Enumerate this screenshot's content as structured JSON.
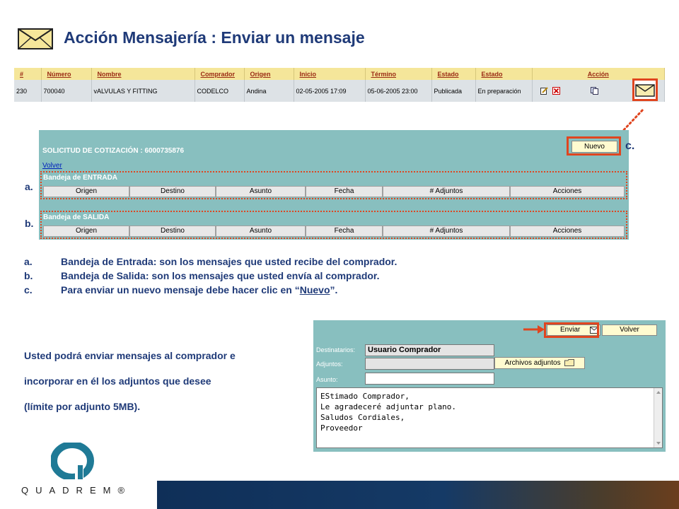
{
  "title": "Acción Mensajería : Enviar un mensaje",
  "colors": {
    "navy": "#1f3a78",
    "highlight": "#e0451f",
    "panel": "#88bfbf",
    "header_bg": "#f5e69a"
  },
  "order_table": {
    "headers": [
      "#",
      "Número",
      "Nombre",
      "Comprador",
      "Origen",
      "Inicio",
      "Término",
      "Estado",
      "Estado",
      "Acción"
    ],
    "row": [
      "230",
      "700040",
      "vALVULAS Y FITTING",
      "CODELCO",
      "Andina",
      "02-05-2005 17:09",
      "05-06-2005 23:00",
      "Publicada",
      "En preparación"
    ],
    "action_icons": [
      "edit-icon",
      "delete-icon",
      "copy-icon",
      "mail-icon"
    ]
  },
  "quote_panel": {
    "title": "SOLICITUD DE COTIZACIÓN : 6000735876",
    "volver_link": "Volver",
    "nuevo_button": "Nuevo",
    "inbox_title": "Bandeja de ENTRADA",
    "outbox_title": "Bandeja de SALIDA",
    "columns": [
      "Origen",
      "Destino",
      "Asunto",
      "Fecha",
      "# Adjuntos",
      "Acciones"
    ]
  },
  "labels": {
    "a": "a.",
    "b": "b.",
    "c": "c."
  },
  "bullets": [
    {
      "key": "a.",
      "text": "Bandeja de Entrada: son los mensajes que usted recibe del comprador."
    },
    {
      "key": "b.",
      "text": "Bandeja de Salida: son los mensajes que usted envía al comprador."
    },
    {
      "key": "c.",
      "text_before": "Para enviar un nuevo mensaje debe hacer clic en ",
      "quote_open": "“",
      "link": "Nuevo",
      "quote_close": "”",
      "text_after": "."
    }
  ],
  "info": [
    "Usted podrá enviar mensajes al comprador e",
    "incorporar en él los adjuntos que desee",
    "(límite por adjunto 5MB)."
  ],
  "compose": {
    "enviar_button": "Enviar",
    "volver_button": "Volver",
    "destinatarios_label": "Destinatarios:",
    "destinatarios_value": "Usuario Comprador",
    "adjuntos_label": "Adjuntos:",
    "archivos_button": "Archivos adjuntos",
    "asunto_label": "Asunto:",
    "message_lines": [
      "EStimado Comprador,",
      "Le agradeceré adjuntar plano.",
      "Saludos Cordiales,",
      "Proveedor"
    ]
  },
  "logo": {
    "text": "QUADREM®"
  }
}
